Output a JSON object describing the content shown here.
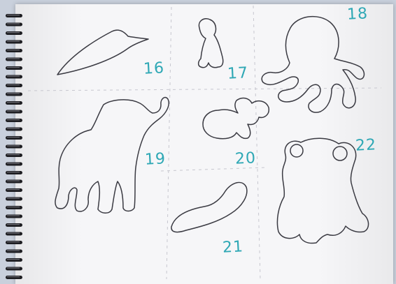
{
  "sketchbook": {
    "labels": {
      "n16": "16",
      "n17": "17",
      "n18": "18",
      "n19": "19",
      "n20": "20",
      "n21": "21",
      "n22": "22"
    },
    "colors": {
      "paper": "#f6f6f8",
      "background": "#c9d0dc",
      "ink": "#3a3a42",
      "number_ink": "#2fa8b5",
      "spiral": "#1e1e22"
    }
  }
}
